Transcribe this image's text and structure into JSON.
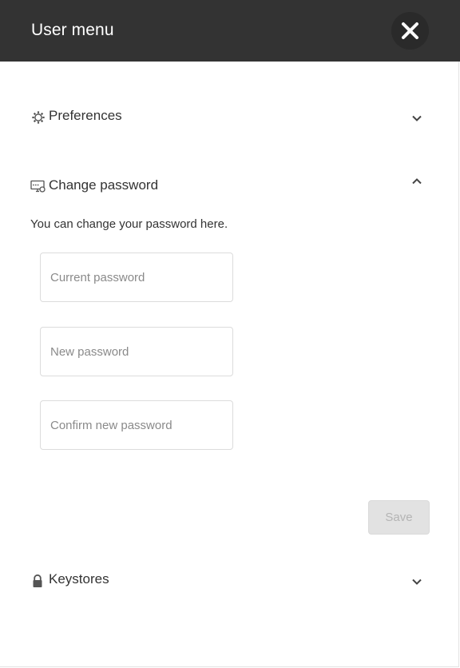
{
  "header": {
    "title": "User menu",
    "close_icon": "close-icon"
  },
  "preferences": {
    "label": "Preferences",
    "icon": "gear-icon",
    "expanded": false
  },
  "change_password": {
    "label": "Change password",
    "icon": "password-icon",
    "expanded": true,
    "hint": "You can change your password here.",
    "current_placeholder": "Current password",
    "new_placeholder": "New password",
    "confirm_placeholder": "Confirm new password",
    "save_label": "Save"
  },
  "keystores": {
    "label": "Keystores",
    "icon": "lock-icon",
    "expanded": false
  },
  "colors": {
    "header_bg": "#333333",
    "text": "#333333",
    "disabled_button": "#e2e2e2"
  }
}
